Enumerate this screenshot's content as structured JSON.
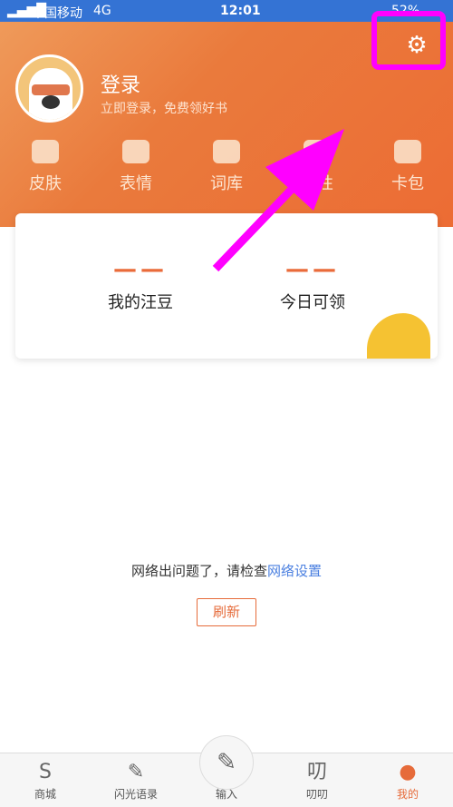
{
  "status": {
    "carrier": "中国移动",
    "network": "4G",
    "time": "12:01",
    "battery": "52%"
  },
  "profile": {
    "title": "登录",
    "subtitle": "立即登录，免费领好书"
  },
  "menu": [
    {
      "label": "皮肤"
    },
    {
      "label": "表情"
    },
    {
      "label": "词库"
    },
    {
      "label": "个性"
    },
    {
      "label": "卡包"
    }
  ],
  "card": {
    "beans_value": "——",
    "beans_label": "我的汪豆",
    "today_value": "——",
    "today_label": "今日可领"
  },
  "error": {
    "text": "网络出问题了，请检查",
    "link": "网络设置",
    "refresh": "刷新"
  },
  "tabs": [
    {
      "label": "商城",
      "icon": "S"
    },
    {
      "label": "闪光语录",
      "icon": "✎"
    },
    {
      "label": "输入",
      "icon": "✎"
    },
    {
      "label": "叨叨",
      "icon": "叨"
    },
    {
      "label": "我的",
      "icon": "●"
    }
  ],
  "accent": "#ea6b3a",
  "annotation_color": "#ff00ff"
}
